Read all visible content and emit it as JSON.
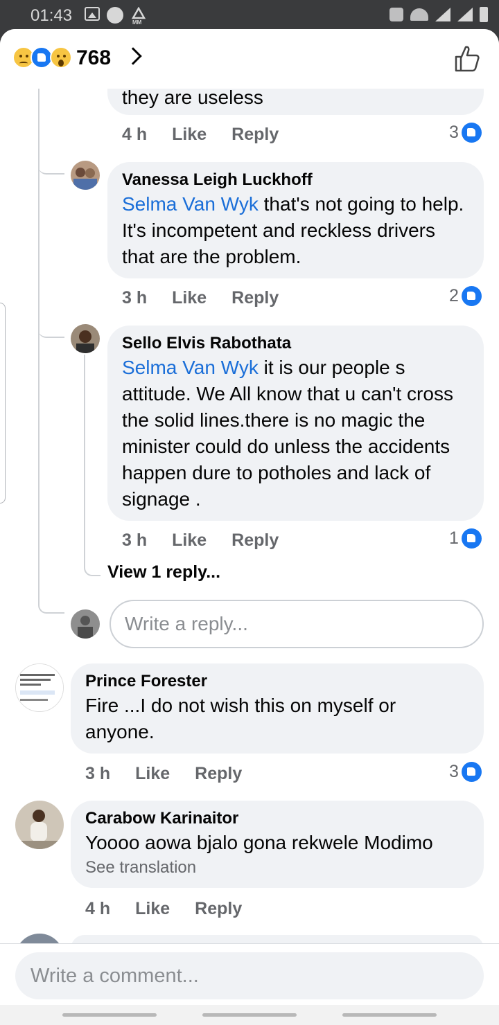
{
  "status_bar": {
    "time": "01:43",
    "icons": [
      "gallery-icon",
      "circle-app-icon",
      "mm-icon",
      "mute-icon",
      "wifi-icon",
      "signal-icon",
      "battery-icon"
    ]
  },
  "header": {
    "reaction_icons": [
      "sad-reaction-icon",
      "like-reaction-icon",
      "wow-reaction-icon"
    ],
    "reaction_count": "768",
    "like_button_icon": "thumbs-up-outline-icon"
  },
  "comments": [
    {
      "author": "",
      "text": "they are useless",
      "time": "4 h",
      "like_label": "Like",
      "reply_label": "Reply",
      "like_count": "3"
    },
    {
      "author": "Vanessa Leigh Luckhoff",
      "mention": "Selma Van Wyk",
      "text": " that's not going to help. It's incompetent and reckless drivers that are the problem.",
      "time": "3 h",
      "like_label": "Like",
      "reply_label": "Reply",
      "like_count": "2"
    },
    {
      "author": "Sello Elvis Rabothata",
      "mention": "Selma Van Wyk",
      "text": " it is our people s attitude. We All  know  that u can't cross the solid lines.there is no magic the minister could do  unless the accidents happen dure to potholes and lack of signage .",
      "time": "3 h",
      "like_label": "Like",
      "reply_label": "Reply",
      "like_count": "1"
    },
    {
      "author": "Prince Forester",
      "text": "Fire ...I do not wish this on myself or anyone.",
      "time": "3 h",
      "like_label": "Like",
      "reply_label": "Reply",
      "like_count": "3"
    },
    {
      "author": "Carabow Karinaitor",
      "text": "Yoooo aowa bjalo gona rekwele Modimo",
      "see_translation": "See translation",
      "time": "4 h",
      "like_label": "Like",
      "reply_label": "Reply"
    }
  ],
  "view_replies": "View 1 reply...",
  "reply_input": {
    "placeholder": "Write a reply..."
  },
  "comment_input": {
    "placeholder": "Write a comment..."
  },
  "colors": {
    "accent": "#1877f2",
    "mention": "#1a6ed8",
    "bubble": "#f0f2f5",
    "meta_text": "#65676b"
  }
}
